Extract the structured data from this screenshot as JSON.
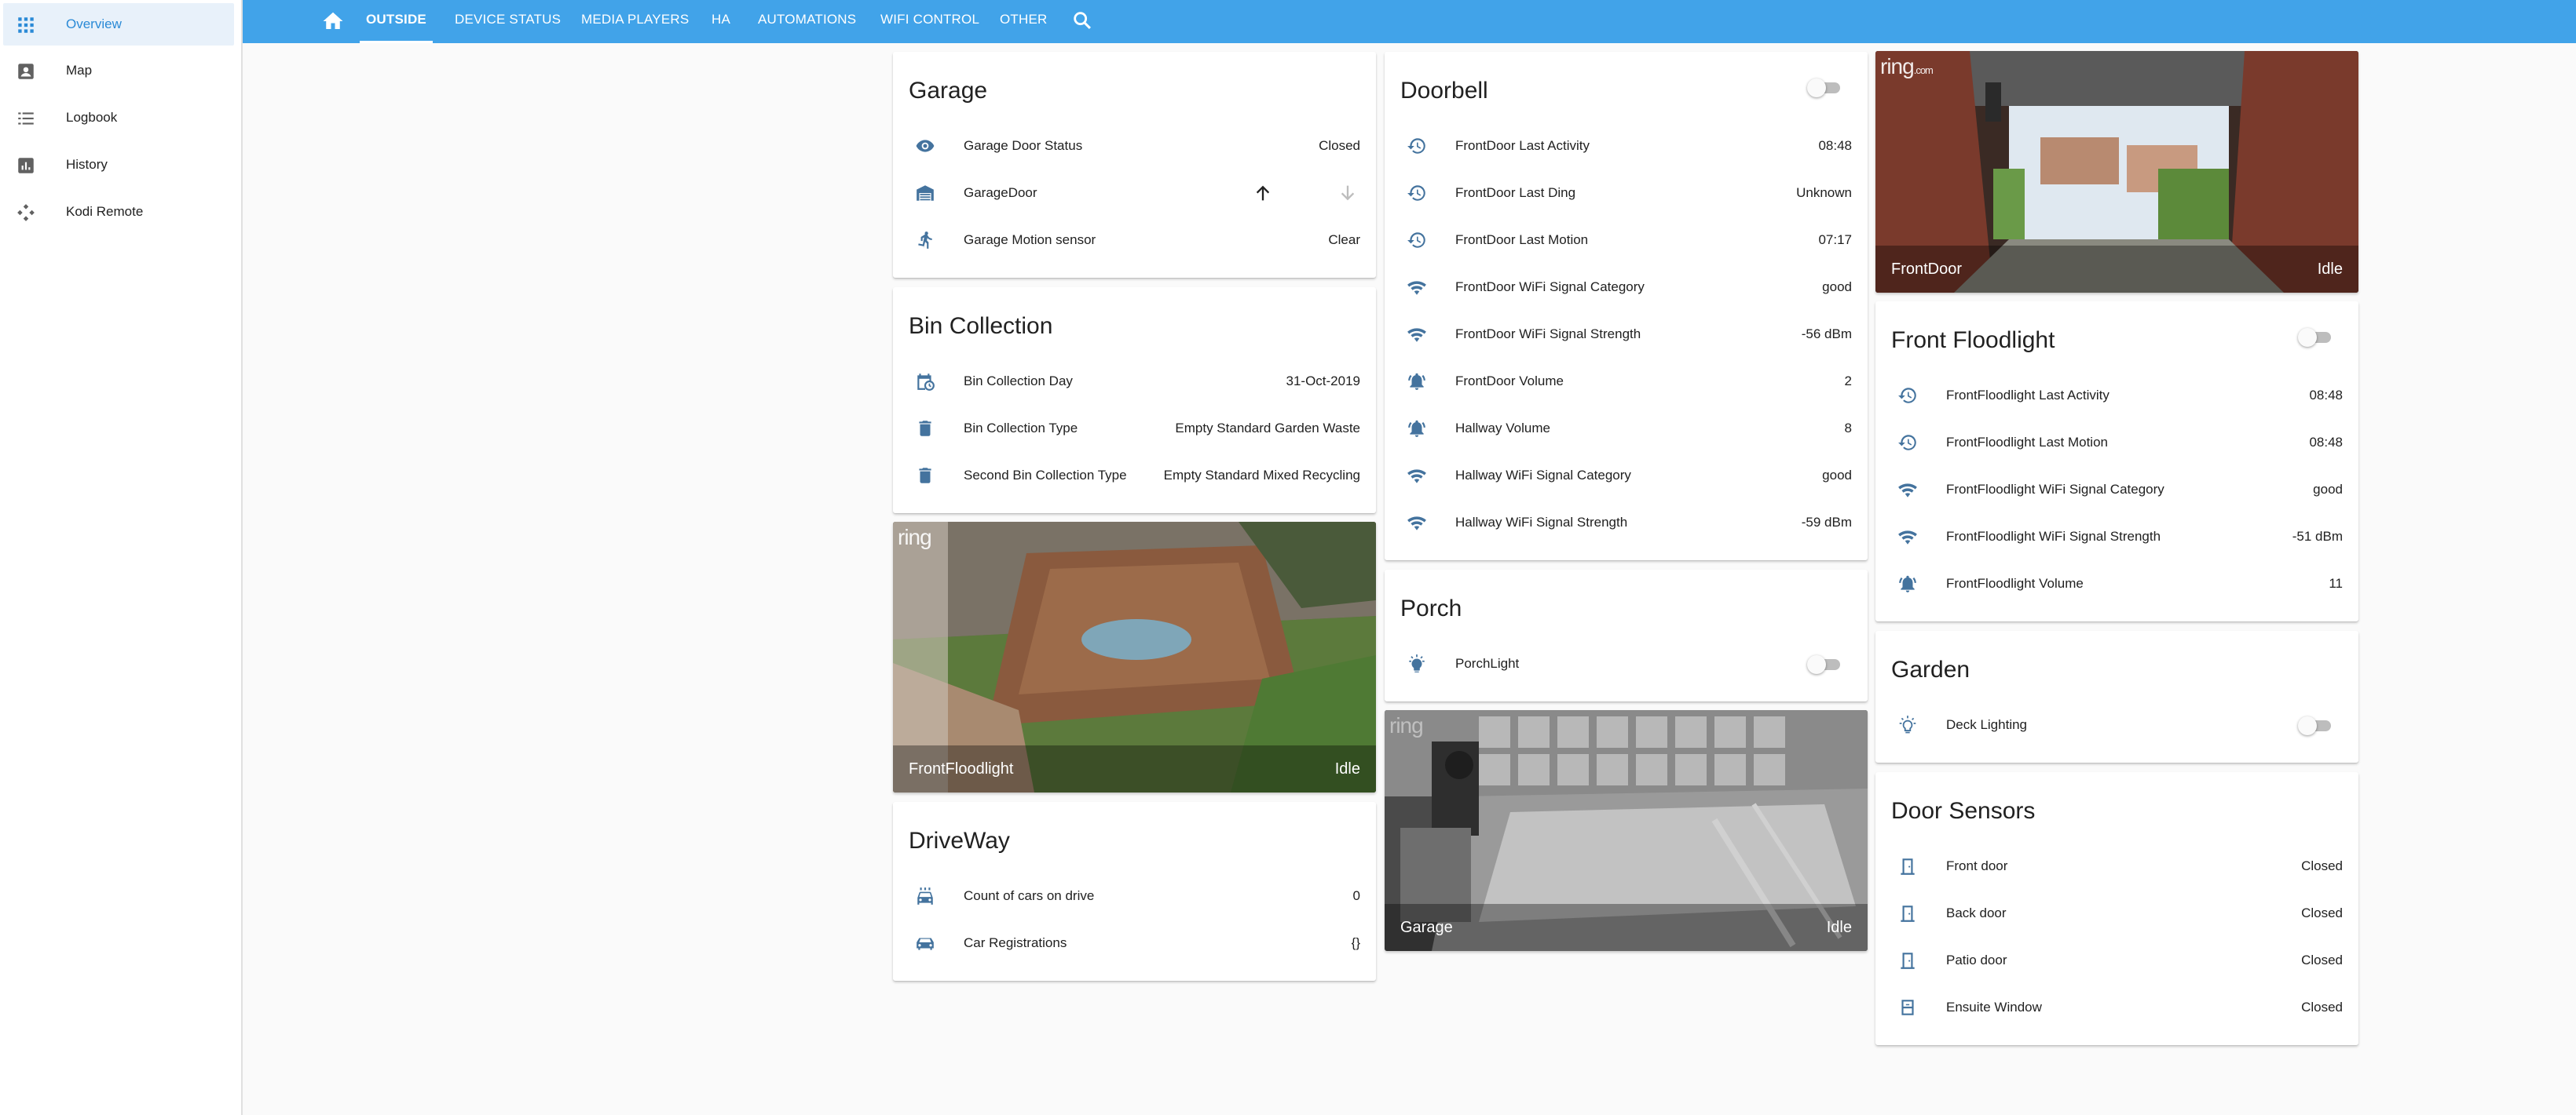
{
  "sidebar": {
    "items": [
      {
        "label": "Overview",
        "icon": "apps-grid-icon"
      },
      {
        "label": "Map",
        "icon": "account-box-icon"
      },
      {
        "label": "Logbook",
        "icon": "list-icon"
      },
      {
        "label": "History",
        "icon": "chart-box-icon"
      },
      {
        "label": "Kodi Remote",
        "icon": "remote-icon"
      }
    ]
  },
  "topbar": {
    "tabs": [
      "OUTSIDE",
      "DEVICE STATUS",
      "MEDIA PLAYERS",
      "HA",
      "AUTOMATIONS",
      "WIFI CONTROL",
      "OTHER"
    ],
    "active_tab": "OUTSIDE"
  },
  "garage": {
    "title": "Garage",
    "rows": [
      {
        "name": "Garage Door Status",
        "value": "Closed",
        "icon": "eye-icon"
      },
      {
        "name": "GarageDoor",
        "value": "",
        "icon": "garage-icon"
      },
      {
        "name": "Garage Motion sensor",
        "value": "Clear",
        "icon": "walk-icon"
      }
    ]
  },
  "bin": {
    "title": "Bin Collection",
    "rows": [
      {
        "name": "Bin Collection Day",
        "value": "31-Oct-2019",
        "icon": "calendar-clock-icon"
      },
      {
        "name": "Bin Collection Type",
        "value": "Empty Standard Garden Waste",
        "icon": "trash-icon"
      },
      {
        "name": "Second Bin Collection Type",
        "value": "Empty Standard Mixed Recycling",
        "icon": "trash-icon"
      }
    ]
  },
  "cams": {
    "floodlight": {
      "name": "FrontFloodlight",
      "state": "Idle",
      "logo": "ring"
    },
    "frontdoor": {
      "name": "FrontDoor",
      "state": "Idle",
      "logo": "ring",
      "logo_suffix": ".com"
    },
    "garage": {
      "name": "Garage",
      "state": "Idle",
      "logo": "ring"
    }
  },
  "driveway": {
    "title": "DriveWay",
    "rows": [
      {
        "name": "Count of cars on drive",
        "value": "0",
        "icon": "car-wash-icon"
      },
      {
        "name": "Car Registrations",
        "value": "{}",
        "icon": "car-icon"
      }
    ]
  },
  "doorbell": {
    "title": "Doorbell",
    "rows": [
      {
        "name": "FrontDoor Last Activity",
        "value": "08:48",
        "icon": "history-icon"
      },
      {
        "name": "FrontDoor Last Ding",
        "value": "Unknown",
        "icon": "history-icon"
      },
      {
        "name": "FrontDoor Last Motion",
        "value": "07:17",
        "icon": "history-icon"
      },
      {
        "name": "FrontDoor WiFi Signal Category",
        "value": "good",
        "icon": "wifi-icon"
      },
      {
        "name": "FrontDoor WiFi Signal Strength",
        "value": "-56 dBm",
        "icon": "wifi-icon"
      },
      {
        "name": "FrontDoor Volume",
        "value": "2",
        "icon": "bell-ring-icon"
      },
      {
        "name": "Hallway Volume",
        "value": "8",
        "icon": "bell-ring-icon"
      },
      {
        "name": "Hallway WiFi Signal Category",
        "value": "good",
        "icon": "wifi-icon"
      },
      {
        "name": "Hallway WiFi Signal Strength",
        "value": "-59 dBm",
        "icon": "wifi-icon"
      }
    ]
  },
  "porch": {
    "title": "Porch",
    "rows": [
      {
        "name": "PorchLight",
        "icon": "lightbulb-on-icon"
      }
    ]
  },
  "floodlight": {
    "title": "Front Floodlight",
    "rows": [
      {
        "name": "FrontFloodlight Last Activity",
        "value": "08:48",
        "icon": "history-icon"
      },
      {
        "name": "FrontFloodlight Last Motion",
        "value": "08:48",
        "icon": "history-icon"
      },
      {
        "name": "FrontFloodlight WiFi Signal Category",
        "value": "good",
        "icon": "wifi-icon"
      },
      {
        "name": "FrontFloodlight WiFi Signal Strength",
        "value": "-51 dBm",
        "icon": "wifi-icon"
      },
      {
        "name": "FrontFloodlight Volume",
        "value": "11",
        "icon": "bell-ring-icon"
      }
    ]
  },
  "garden": {
    "title": "Garden",
    "rows": [
      {
        "name": "Deck Lighting",
        "icon": "lightbulb-outline-icon"
      }
    ]
  },
  "doors": {
    "title": "Door Sensors",
    "rows": [
      {
        "name": "Front door",
        "value": "Closed",
        "icon": "door-closed-icon"
      },
      {
        "name": "Back door",
        "value": "Closed",
        "icon": "door-closed-icon"
      },
      {
        "name": "Patio door",
        "value": "Closed",
        "icon": "door-closed-icon"
      },
      {
        "name": "Ensuite Window",
        "value": "Closed",
        "icon": "window-closed-icon"
      }
    ]
  },
  "colors": {
    "topbar": "#41a3e9",
    "icon": "#44739e",
    "active_text": "#2a8ad6"
  }
}
